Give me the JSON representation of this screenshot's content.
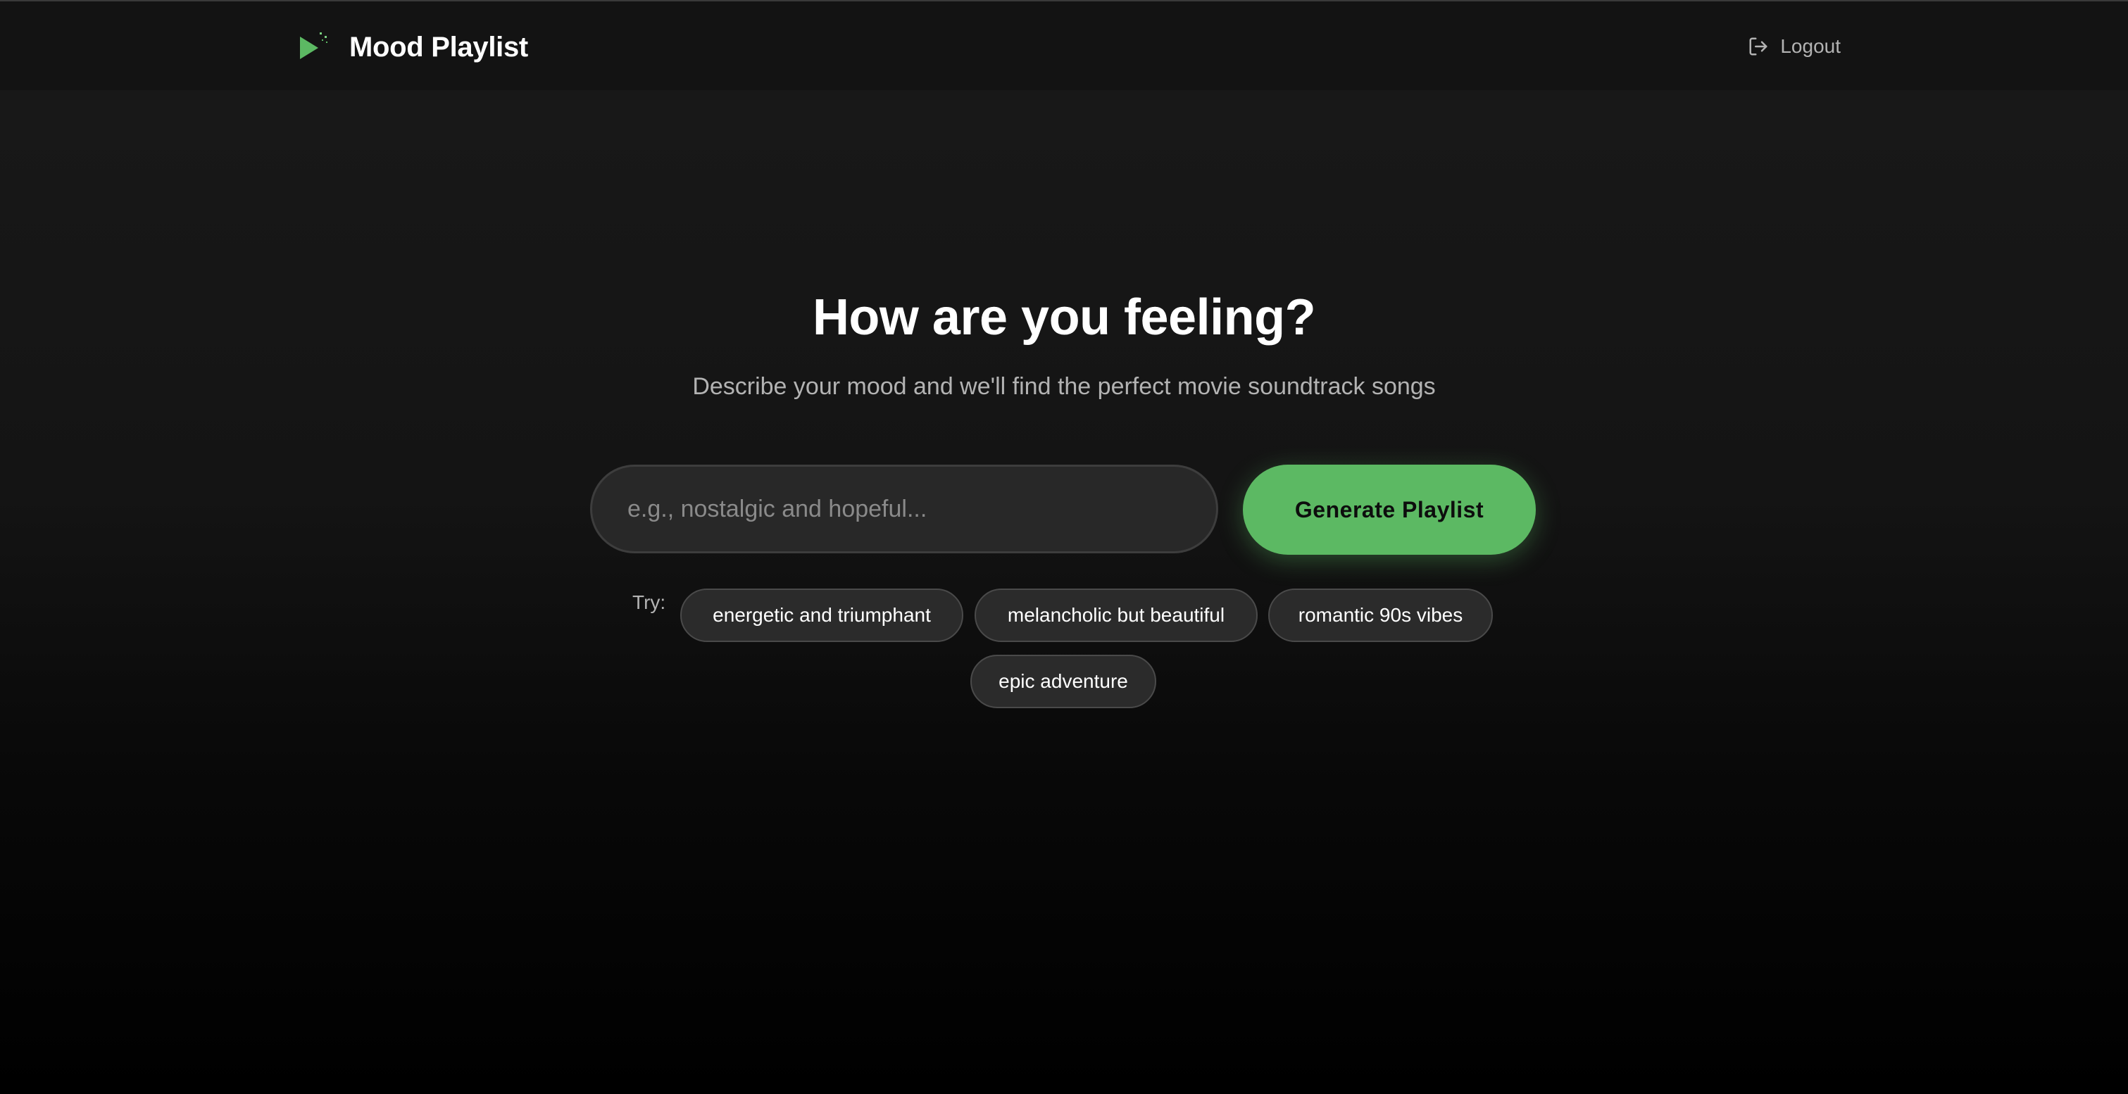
{
  "header": {
    "brand_title": "Mood Playlist",
    "brand_icon": "play-sparkle-icon",
    "logout_label": "Logout",
    "logout_icon": "logout-icon"
  },
  "hero": {
    "title": "How are you feeling?",
    "subtitle": "Describe your mood and we'll find the perfect movie soundtrack songs"
  },
  "search": {
    "value": "",
    "placeholder": "e.g., nostalgic and hopeful...",
    "button_label": "Generate Playlist"
  },
  "suggestions": {
    "label": "Try:",
    "items": [
      "energetic and triumphant",
      "melancholic but beautiful",
      "romantic 90s vibes",
      "epic adventure"
    ]
  },
  "colors": {
    "accent": "#5cb963",
    "background_top": "#191919",
    "background_bottom": "#000000",
    "header_bg": "#131313",
    "muted_text": "#b3b3b3",
    "chip_bg": "#2b2b2b",
    "input_bg": "#282828"
  }
}
